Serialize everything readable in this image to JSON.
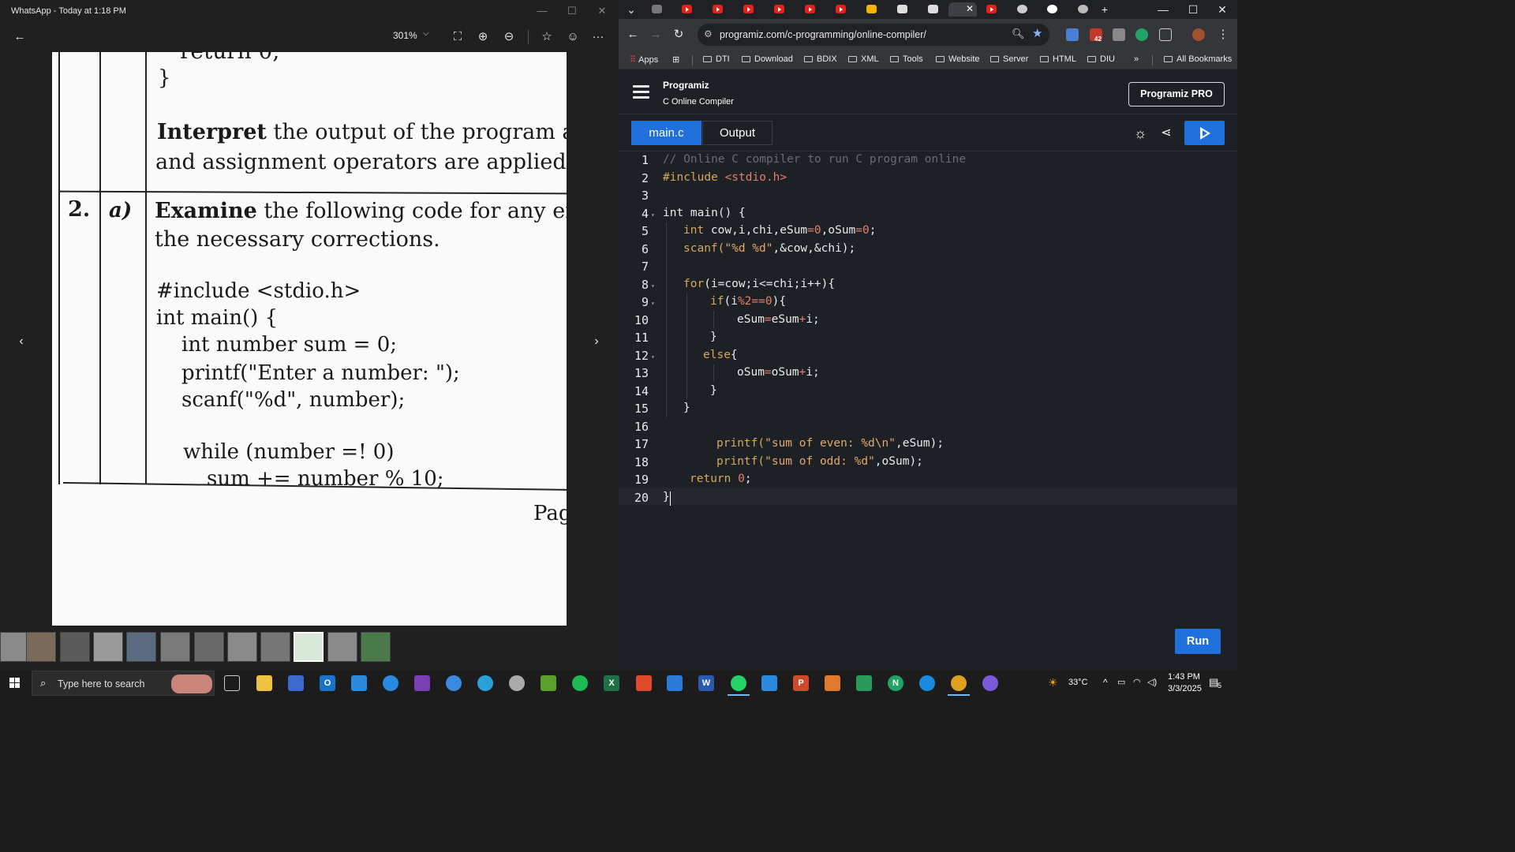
{
  "whatsapp": {
    "title": "WhatsApp - Today at 1:18 PM",
    "zoom": "301%",
    "document": {
      "snippet_return": "return 0;",
      "brace": "}",
      "interpret_line1_bold": "Interpret",
      "interpret_line1_rest": " the output of the program and",
      "interpret_line2": "and assignment operators are applied in the",
      "q_number": "2.",
      "q_part": "a)",
      "examine_bold": "Examine",
      "examine_rest": " the following code for any erro",
      "examine_line2": "the necessary corrections.",
      "code_lines": [
        "#include <stdio.h>",
        "int main() {",
        "int number sum = 0;",
        "printf(\"Enter a number: \");",
        "scanf(\"%d\", number);",
        "while (number =! 0)",
        "sum += number % 10;"
      ],
      "page_label": "Pag"
    }
  },
  "chrome": {
    "url": "programiz.com/c-programming/online-compiler/",
    "bookmarks": [
      "Apps",
      "DTI",
      "Download",
      "BDIX",
      "XML",
      "Tools",
      "Website",
      "Server",
      "HTML",
      "DIU",
      "All Bookmarks"
    ],
    "ext_badge": "42"
  },
  "programiz": {
    "logo": "Programiz",
    "subtitle": "C Online Compiler",
    "pro_button": "Programiz PRO",
    "tab_main": "main.c",
    "tab_output": "Output",
    "run_label": "Run",
    "line_numbers": [
      "1",
      "2",
      "3",
      "4",
      "5",
      "6",
      "7",
      "8",
      "9",
      "10",
      "11",
      "12",
      "13",
      "14",
      "15",
      "16",
      "17",
      "18",
      "19",
      "20"
    ],
    "code": {
      "l1": "// Online C compiler to run C program online",
      "l2_a": "#include ",
      "l2_b": "<stdio.h>",
      "l4_a": "int",
      "l4_b": " main() {",
      "l5_a": "int",
      "l5_b": " cow,i,chi,eSum",
      "l5_c": "=0",
      "l5_d": ",oSum",
      "l5_e": "=0",
      "l5_f": ";",
      "l6_a": "scanf(",
      "l6_b": "\"%d %d\"",
      "l6_c": ",&cow,&chi);",
      "l8_a": "for",
      "l8_b": "(i=cow;i<=chi;i++){",
      "l9_a": "if",
      "l9_b": "(i",
      "l9_c": "%2==0",
      "l9_d": "){",
      "l10_a": "eSum",
      "l10_b": "=",
      "l10_c": "eSum",
      "l10_d": "+",
      "l10_e": "i;",
      "l11": "}",
      "l12_a": "else",
      "l12_b": "{",
      "l13_a": "oSum",
      "l13_b": "=",
      "l13_c": "oSum",
      "l13_d": "+",
      "l13_e": "i;",
      "l14": "}",
      "l15": "}",
      "l17_a": "printf(",
      "l17_b": "\"sum of even: %d\\n\"",
      "l17_c": ",eSum);",
      "l18_a": "printf(",
      "l18_b": "\"sum of odd: %d\"",
      "l18_c": ",oSum);",
      "l19_a": "return ",
      "l19_b": "0",
      "l19_c": ";",
      "l20": "}"
    }
  },
  "taskbar": {
    "search_placeholder": "Type here to search",
    "temperature": "33°C",
    "time": "1:43 PM",
    "date": "3/3/2025",
    "notification_count": "5"
  },
  "colors": {
    "accent_blue": "#1f6fdc",
    "editor_bg": "#1d2025",
    "keyword": "#d6a85a",
    "operator": "#e57f6a",
    "comment": "#676c75"
  }
}
